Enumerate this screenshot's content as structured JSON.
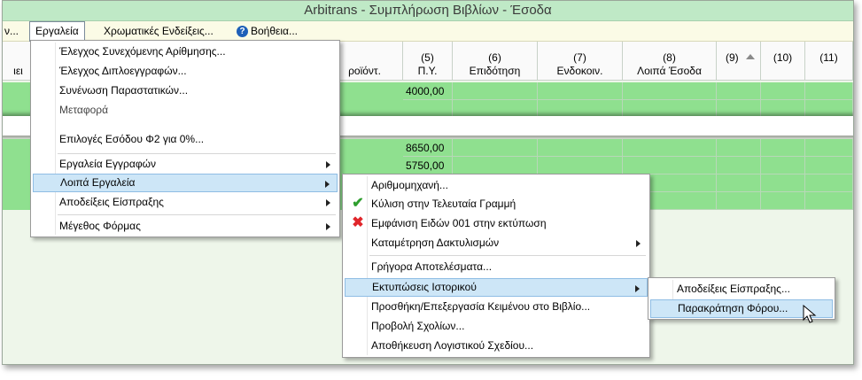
{
  "window": {
    "title": "Arbitrans - Συμπλήρωση Βιβλίων - Έσοδα"
  },
  "menubar": {
    "left_fragment": "ν...",
    "tools": "Εργαλεία",
    "colors": "Χρωματικές Ενδείξεις...",
    "help": "Βοήθεια...",
    "help_glyph": "?"
  },
  "grid": {
    "headers": [
      {
        "num": "",
        "label": "ιει"
      },
      {
        "num": "",
        "label": "ροϊόντ."
      },
      {
        "num": "(5)",
        "label": "Π.Υ."
      },
      {
        "num": "(6)",
        "label": "Επιδότηση"
      },
      {
        "num": "(7)",
        "label": "Ενδοκοιν."
      },
      {
        "num": "(8)",
        "label": "Λοιπά Έσοδα"
      },
      {
        "num": "(9)",
        "label": ""
      },
      {
        "num": "(10)",
        "label": ""
      },
      {
        "num": "(11)",
        "label": ""
      }
    ],
    "values": [
      "4000,00",
      "8650,00",
      "5750,00"
    ]
  },
  "tools_menu": {
    "items": [
      "Έλεγχος Συνεχόμενης Αρίθμησης...",
      "Έλεγχος Διπλοεγγραφών...",
      "Συνένωση Παραστατικών...",
      "Μεταφορά",
      "Επιλογές Εσόδου Φ2 για 0%...",
      "Εργαλεία Εγγραφών",
      "Λοιπά Εργαλεία",
      "Αποδείξεις Είσπραξης",
      "Μέγεθος Φόρμας"
    ]
  },
  "other_tools_menu": {
    "items": [
      "Αριθμομηχανή...",
      "Κύλιση στην Τελευταία Γραμμή",
      "Εμφάνιση Ειδών 001 στην εκτύπωση",
      "Καταμέτρηση Δακτυλισμών",
      "Γρήγορα Αποτελέσματα...",
      "Εκτυπώσεις Ιστορικού",
      "Προσθήκη/Επεξεργασία Κειμένου στο Βιβλίο...",
      "Προβολή Σχολίων...",
      "Αποθήκευση Λογιστικού Σχεδίου..."
    ]
  },
  "history_prints_menu": {
    "items": [
      "Αποδείξεις Είσπραξης...",
      "Παρακράτηση Φόρου..."
    ]
  },
  "colors": {
    "check": "#2e9e2e",
    "cross": "#e0262b",
    "row_green": "#8fe08f",
    "highlight": "#cde6f7"
  }
}
